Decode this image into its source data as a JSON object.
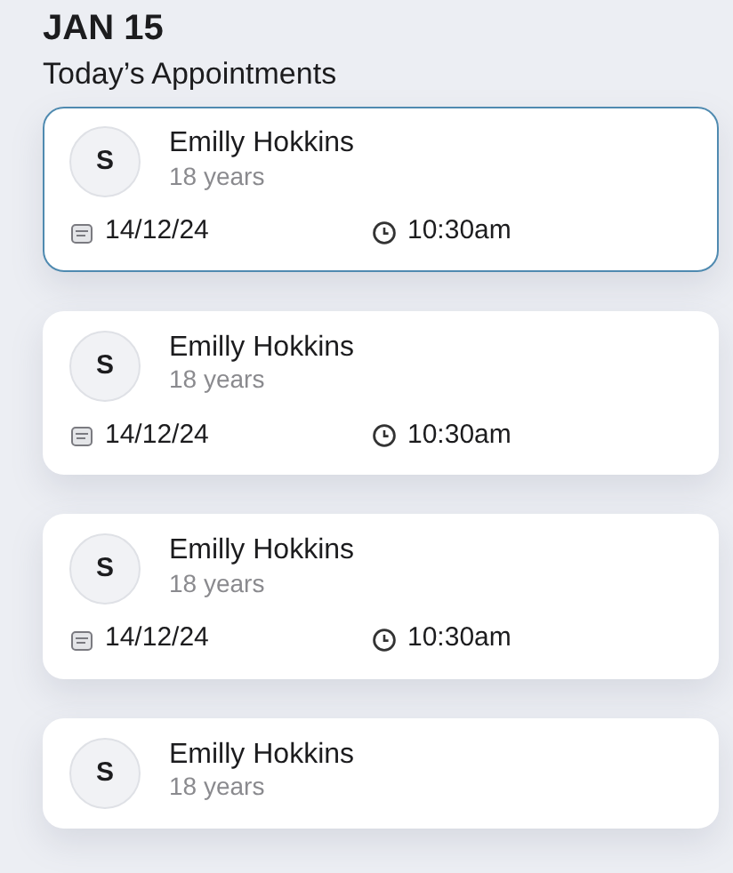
{
  "header": {
    "date": "JAN 15",
    "subtitle": "Today’s Appointments"
  },
  "appointments": [
    {
      "initial": "S",
      "name": "Emilly Hokkins",
      "age": "18 years",
      "date": "14/12/24",
      "time": "10:30am",
      "selected": true
    },
    {
      "initial": "S",
      "name": "Emilly Hokkins",
      "age": "18 years",
      "date": "14/12/24",
      "time": "10:30am",
      "selected": false
    },
    {
      "initial": "S",
      "name": "Emilly Hokkins",
      "age": "18 years",
      "date": "14/12/24",
      "time": "10:30am",
      "selected": false
    },
    {
      "initial": "S",
      "name": "Emilly Hokkins",
      "age": "18 years",
      "selected": false
    }
  ]
}
